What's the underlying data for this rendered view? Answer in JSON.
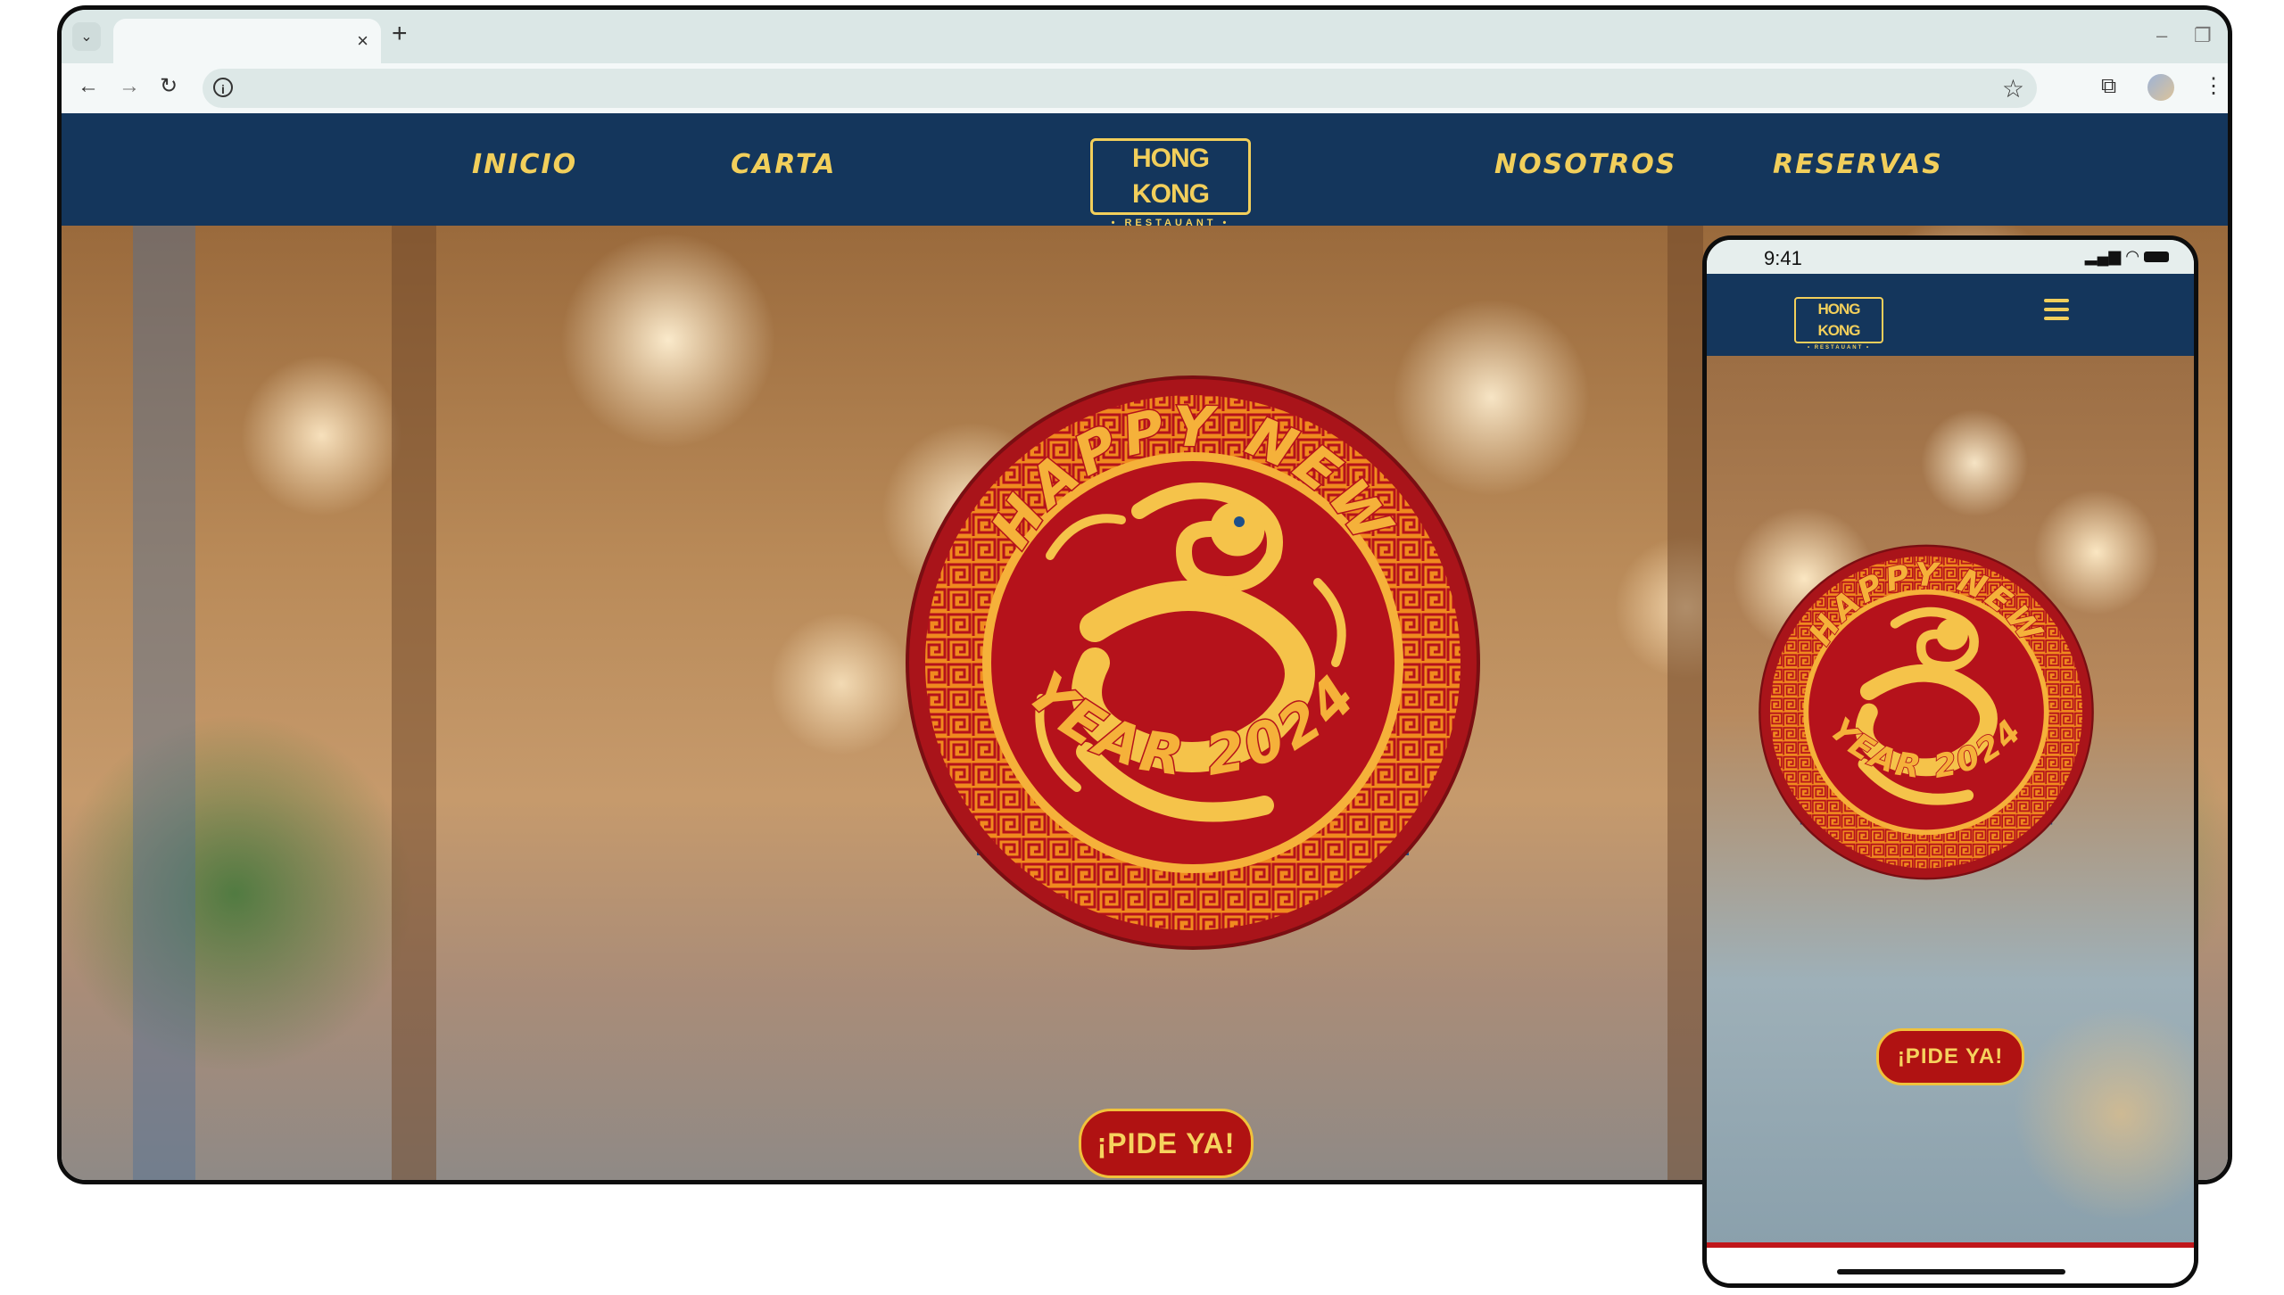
{
  "browser": {
    "tab_title": "",
    "address": "",
    "new_tab_label": "+",
    "tab_close_label": "×"
  },
  "site": {
    "logo": {
      "name": "HONG KONG",
      "subtitle": "• RESTAUANT •"
    },
    "nav": {
      "inicio": "INICIO",
      "carta": "CARTA",
      "nosotros": "NOSOTROS",
      "reservas": "RESERVAS"
    },
    "emblem": {
      "top_text": "HAPPY NEW",
      "bottom_text": "YEAR 2024"
    },
    "cta_label": "¡PIDE YA!"
  },
  "mobile": {
    "status_time": "9:41",
    "logo": {
      "name": "HONG KONG",
      "subtitle": "• RESTAUANT •"
    },
    "emblem": {
      "top_text": "HAPPY NEW",
      "bottom_text": "YEAR 2024"
    },
    "cta_label": "¡PIDE YA!"
  },
  "colors": {
    "nav_bg": "#14365c",
    "accent_gold": "#f2cf5b",
    "emblem_red": "#b5121b",
    "emblem_orange": "#f08a1f",
    "cta_red": "#b01212"
  },
  "icons": [
    "tab-search-icon",
    "close-icon",
    "plus-icon",
    "minimize-icon",
    "maximize-icon",
    "close-window-icon",
    "back-icon",
    "forward-icon",
    "reload-icon",
    "info-icon",
    "star-icon",
    "extensions-icon",
    "avatar",
    "menu-dots-icon",
    "signal-icon",
    "wifi-icon",
    "battery-icon",
    "hamburger-icon",
    "dragon-icon"
  ]
}
